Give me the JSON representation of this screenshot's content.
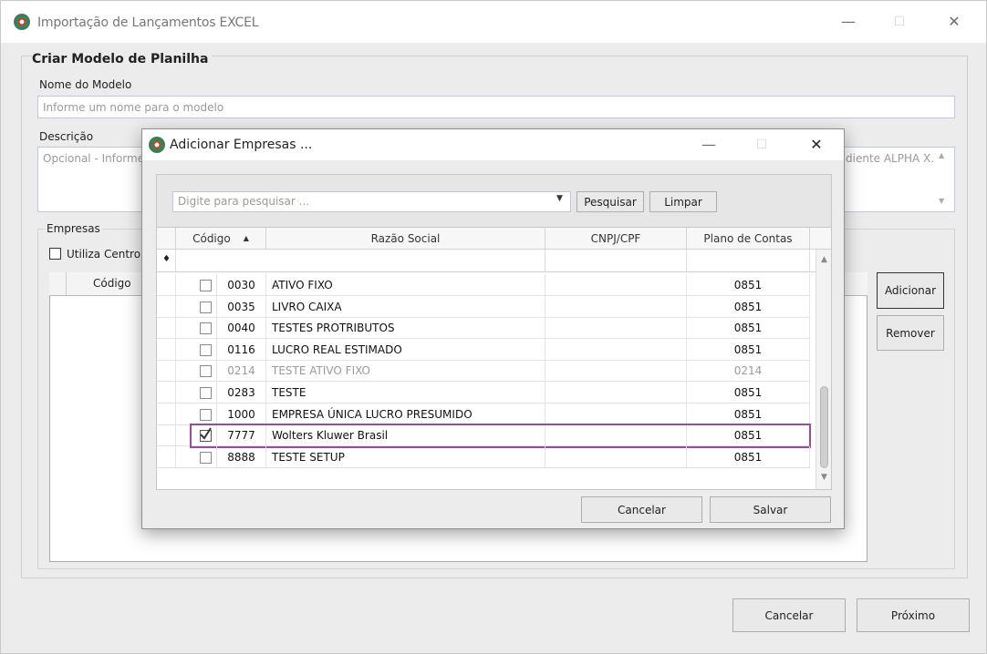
{
  "window": {
    "title": "Importação de Lançamentos EXCEL",
    "minimize_glyph": "—",
    "maximize_glyph": "☐",
    "close_glyph": "✕"
  },
  "form": {
    "group_title": "Criar Modelo de Planilha",
    "nome_label": "Nome do Modelo",
    "nome_placeholder": "Informe um nome para o modelo",
    "descricao_label": "Descrição",
    "descricao_placeholder_left": "Opcional - Informe",
    "descricao_placeholder_right": "diente ALPHA X.",
    "empresas_label": "Empresas",
    "utiliza_centro_label": "Utiliza Centro",
    "grid_codigo_header": "Código",
    "adicionar_label": "Adicionar",
    "remover_label": "Remover",
    "cancelar_label": "Cancelar",
    "proximo_label": "Próximo"
  },
  "dialog": {
    "title": "Adicionar Empresas ...",
    "search_placeholder": "Digite para pesquisar ...",
    "pesquisar_label": "Pesquisar",
    "limpar_label": "Limpar",
    "columns": {
      "codigo": "Código",
      "sort_glyph": "▲",
      "razao_social": "Razão Social",
      "cnpj": "CNPJ/CPF",
      "plano": "Plano de Contas"
    },
    "filter_icon_glyph": "♦",
    "rows": [
      {
        "codigo": "0030",
        "razao": "ATIVO FIXO",
        "cnpj": "",
        "plano": "0851",
        "checked": false,
        "disabled": false
      },
      {
        "codigo": "0035",
        "razao": "LIVRO CAIXA",
        "cnpj": "",
        "plano": "0851",
        "checked": false,
        "disabled": false
      },
      {
        "codigo": "0040",
        "razao": "TESTES PROTRIBUTOS",
        "cnpj": "",
        "plano": "0851",
        "checked": false,
        "disabled": false
      },
      {
        "codigo": "0116",
        "razao": "LUCRO REAL ESTIMADO",
        "cnpj": "",
        "plano": "0851",
        "checked": false,
        "disabled": false
      },
      {
        "codigo": "0214",
        "razao": "TESTE ATIVO FIXO",
        "cnpj": "",
        "plano": "0214",
        "checked": false,
        "disabled": true
      },
      {
        "codigo": "0283",
        "razao": "TESTE",
        "cnpj": "",
        "plano": "0851",
        "checked": false,
        "disabled": false
      },
      {
        "codigo": "1000",
        "razao": "EMPRESA ÚNICA LUCRO PRESUMIDO",
        "cnpj": "",
        "plano": "0851",
        "checked": false,
        "disabled": false
      },
      {
        "codigo": "7777",
        "razao": "Wolters Kluwer Brasil",
        "cnpj": "",
        "plano": "0851",
        "checked": true,
        "disabled": false
      },
      {
        "codigo": "8888",
        "razao": "TESTE SETUP",
        "cnpj": "",
        "plano": "0851",
        "checked": false,
        "disabled": false
      }
    ],
    "cancelar_label": "Cancelar",
    "salvar_label": "Salvar",
    "highlight_color": "#9b4aa0"
  }
}
